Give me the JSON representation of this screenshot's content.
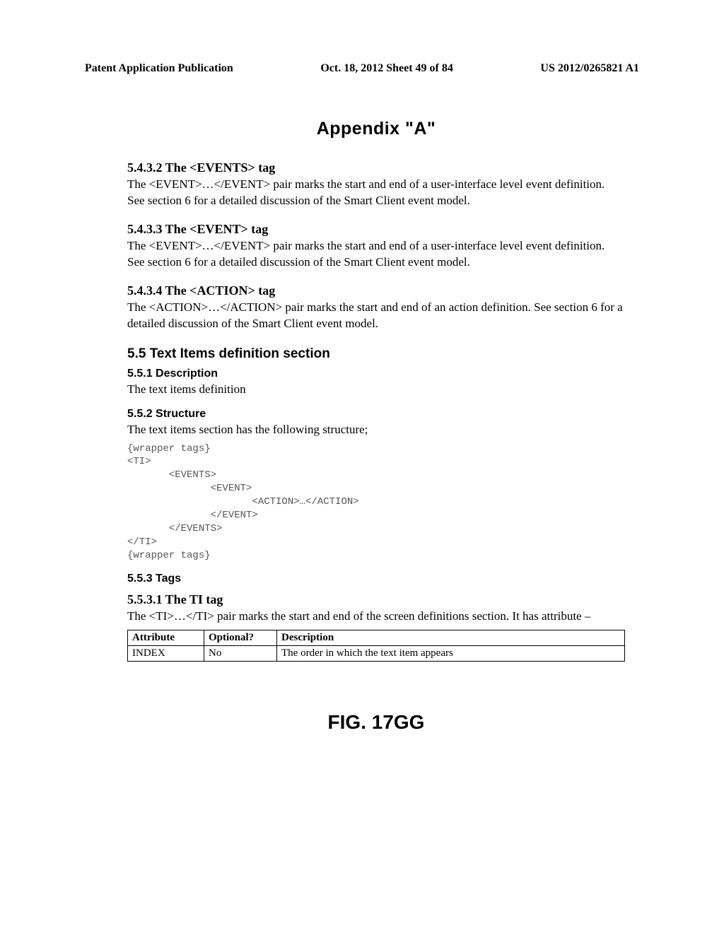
{
  "header": {
    "left": "Patent Application Publication",
    "center": "Oct. 18, 2012  Sheet 49 of 84",
    "right": "US 2012/0265821 A1"
  },
  "appendix_title": "Appendix \"A\"",
  "s5432": {
    "heading": "5.4.3.2  The <EVENTS> tag",
    "body": "The <EVENT>…</EVENT> pair marks the start and end of a user-interface level event definition. See section 6 for a detailed discussion of the Smart Client event model."
  },
  "s5433": {
    "heading": "5.4.3.3  The <EVENT> tag",
    "body": "The <EVENT>…</EVENT> pair marks the start and end of a user-interface level event definition. See section 6 for a detailed discussion of the Smart Client event model."
  },
  "s5434": {
    "heading": "5.4.3.4  The <ACTION> tag",
    "body": "The <ACTION>…</ACTION> pair marks the start and end of an action definition. See section 6 for a detailed discussion of the Smart Client event model."
  },
  "s55": {
    "heading": "5.5  Text Items definition section"
  },
  "s551": {
    "heading": "5.5.1  Description",
    "body": "The text items definition"
  },
  "s552": {
    "heading": "5.5.2  Structure",
    "body": "The text items section has the following structure;",
    "code": "{wrapper tags}\n<TI>\n       <EVENTS>\n              <EVENT>\n                     <ACTION>…</ACTION>\n              </EVENT>\n       </EVENTS>\n</TI>\n{wrapper tags}"
  },
  "s553": {
    "heading": "5.5.3  Tags"
  },
  "s5531": {
    "heading": "5.5.3.1  The TI tag",
    "body": "The <TI>…</TI> pair marks the start and end of the screen definitions section. It has attribute –"
  },
  "table": {
    "head": {
      "c0": "Attribute",
      "c1": "Optional?",
      "c2": "Description"
    },
    "row0": {
      "c0": "INDEX",
      "c1": "No",
      "c2": "The order in which the text item appears"
    }
  },
  "figure_label": "FIG. 17GG"
}
